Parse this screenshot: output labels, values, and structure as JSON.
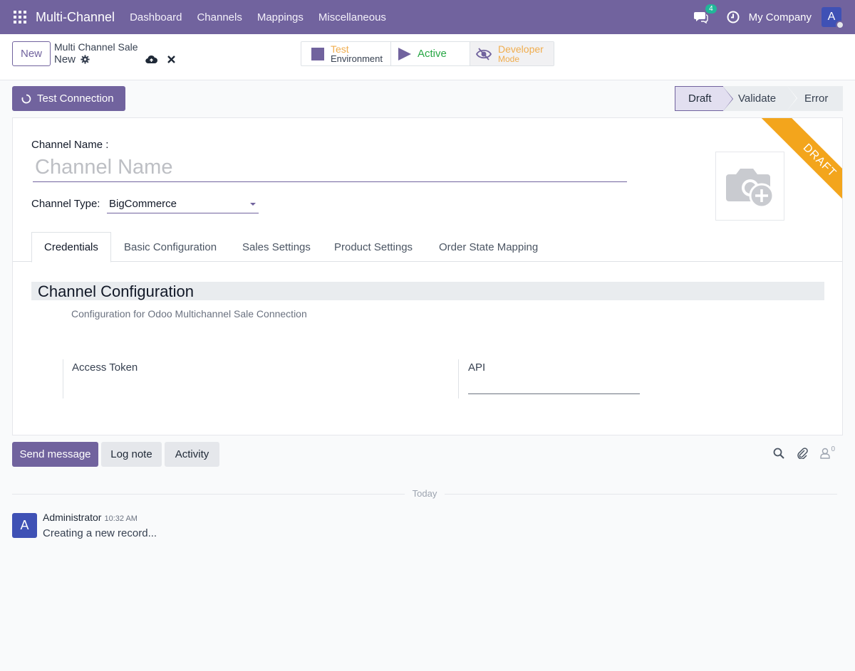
{
  "navbar": {
    "app_name": "Multi-Channel",
    "menu": [
      "Dashboard",
      "Channels",
      "Mappings",
      "Miscellaneous"
    ],
    "messages_count": "4",
    "company": "My Company",
    "user_initial": "A"
  },
  "control_panel": {
    "new_label": "New",
    "breadcrumb_parent": "Multi Channel Sale",
    "breadcrumb_current": "New",
    "smart_buttons": {
      "test_line1": "Test",
      "test_line2": "Environment",
      "active": "Active",
      "dev_line1": "Developer",
      "dev_line2": "Mode"
    }
  },
  "actions": {
    "test_connection": "Test Connection"
  },
  "statusbar": {
    "stages": [
      "Draft",
      "Validate",
      "Error"
    ],
    "current": "Draft"
  },
  "form": {
    "ribbon": "DRAFT",
    "channel_name_label": "Channel Name :",
    "channel_name_value": "",
    "channel_name_placeholder": "Channel Name",
    "channel_type_label": "Channel Type:",
    "channel_type_value": "BigCommerce",
    "tabs": [
      "Credentials",
      "Basic Configuration",
      "Sales Settings",
      "Product Settings",
      "Order State Mapping"
    ],
    "active_tab": "Credentials",
    "section_title": "Channel Configuration",
    "section_desc": "Configuration for Odoo Multichannel Sale Connection",
    "settings": {
      "access_token_label": "Access Token",
      "api_label": "API",
      "api_value": ""
    }
  },
  "chatter": {
    "send_message": "Send message",
    "log_note": "Log note",
    "activity": "Activity",
    "followers_count": "0",
    "date_separator": "Today",
    "messages": [
      {
        "avatar": "A",
        "author": "Administrator",
        "time": "10:32 AM",
        "body": "Creating a new record..."
      }
    ]
  },
  "colors": {
    "brand": "#71639e",
    "ribbon": "#f3a51c",
    "active_green": "#28a745",
    "warning": "#f0ad4e"
  },
  "icons": [
    "apps-icon",
    "chat-icon",
    "clock-icon",
    "gear-icon",
    "cloud-upload-icon",
    "close-icon",
    "square-icon",
    "play-icon",
    "eye-slash-icon",
    "refresh-icon",
    "camera-plus-icon",
    "search-icon",
    "paperclip-icon",
    "user-icon"
  ]
}
